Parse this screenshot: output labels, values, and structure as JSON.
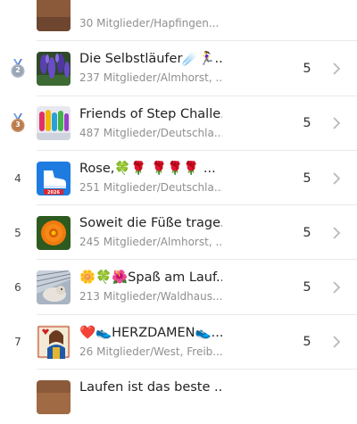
{
  "rows": [
    {
      "rank": "",
      "title": "",
      "subtitle": "30 Mitglieder/Hapfingen...",
      "count": "",
      "thumb": "brown-photo"
    },
    {
      "rank": "2",
      "medal": "silver",
      "title": "Die Selbstläufer☄️🏃‍♀️...",
      "subtitle": "237 Mitglieder/Almhorst, ...",
      "count": "5",
      "thumb": "purple-flowers"
    },
    {
      "rank": "3",
      "medal": "bronze",
      "title": "Friends of Step Challe...",
      "subtitle": "487 Mitglieder/Deutschla...",
      "count": "5",
      "thumb": "colorful-runners"
    },
    {
      "rank": "4",
      "title": "Rose,🍀🌹 🌹🌹🌹 ...",
      "subtitle": "251 Mitglieder/Deutschla...",
      "count": "5",
      "thumb": "shoe-app-2026"
    },
    {
      "rank": "5",
      "title": "Soweit die Füße trage...",
      "subtitle": "245 Mitglieder/Almhorst, ...",
      "count": "5",
      "thumb": "orange-flower"
    },
    {
      "rank": "6",
      "title": "🌼🍀🌺Spaß am Lauf...",
      "subtitle": "213 Mitglieder/Waldhaus...",
      "count": "5",
      "thumb": "cat-photo"
    },
    {
      "rank": "7",
      "title": "❤️👟HERZDAMEN👟...",
      "subtitle": "26 Mitglieder/West, Freib...",
      "count": "5",
      "thumb": "queen-of-hearts-card"
    },
    {
      "rank": "",
      "title": "Laufen ist das beste ...",
      "subtitle": "",
      "count": "",
      "thumb": "brown-photo"
    }
  ],
  "colors": {
    "silver_medal": "#a9b3c1",
    "bronze_medal": "#c98a5e",
    "divider": "#e9e9e9",
    "subtitle": "#8f8f8f",
    "chevron": "#b9b9b9"
  }
}
